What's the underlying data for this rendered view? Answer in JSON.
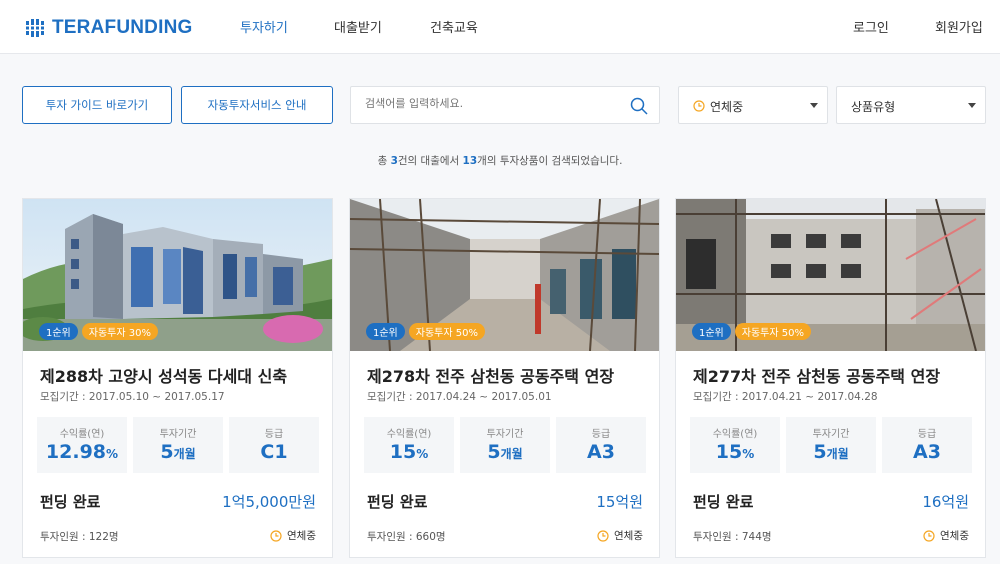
{
  "header": {
    "logo_text": "TERAFUNDING",
    "nav": [
      "투자하기",
      "대출받기",
      "건축교육"
    ],
    "login": "로그인",
    "signup": "회원가입"
  },
  "toolbar": {
    "guide_button": "투자 가이드 바로가기",
    "auto_button": "자동투자서비스 안내",
    "search_placeholder": "검색어를 입력하세요.",
    "status_select": "연체중",
    "type_select": "상품유형"
  },
  "result": {
    "prefix": "총 ",
    "loans": "3",
    "middle": "건의 대출에서 ",
    "products": "13",
    "suffix": "개의 투자상품이 검색되었습니다."
  },
  "colors": {
    "accent": "#1e6fc2",
    "orange": "#f5a623"
  },
  "cards": [
    {
      "rank": "1순위",
      "auto_badge": "자동투자 30%",
      "title": "제288차 고양시 성석동 다세대 신축",
      "period": "모집기간 : 2017.05.10 ~ 2017.05.17",
      "yield_label": "수익률(연)",
      "yield_value": "12.98",
      "yield_unit": "%",
      "term_label": "투자기간",
      "term_value": "5",
      "term_unit": "개월",
      "grade_label": "등급",
      "grade_value": "C1",
      "status": "펀딩 완료",
      "amount": "1억5,000만원",
      "investors": "투자인원 : 122명",
      "card_status": "연체중"
    },
    {
      "rank": "1순위",
      "auto_badge": "자동투자 50%",
      "title": "제278차 전주 삼천동 공동주택 연장",
      "period": "모집기간 : 2017.04.24 ~ 2017.05.01",
      "yield_label": "수익률(연)",
      "yield_value": "15",
      "yield_unit": "%",
      "term_label": "투자기간",
      "term_value": "5",
      "term_unit": "개월",
      "grade_label": "등급",
      "grade_value": "A3",
      "status": "펀딩 완료",
      "amount": "15억원",
      "investors": "투자인원 : 660명",
      "card_status": "연체중"
    },
    {
      "rank": "1순위",
      "auto_badge": "자동투자 50%",
      "title": "제277차 전주 삼천동 공동주택 연장",
      "period": "모집기간 : 2017.04.21 ~ 2017.04.28",
      "yield_label": "수익률(연)",
      "yield_value": "15",
      "yield_unit": "%",
      "term_label": "투자기간",
      "term_value": "5",
      "term_unit": "개월",
      "grade_label": "등급",
      "grade_value": "A3",
      "status": "펀딩 완료",
      "amount": "16억원",
      "investors": "투자인원 : 744명",
      "card_status": "연체중"
    }
  ]
}
